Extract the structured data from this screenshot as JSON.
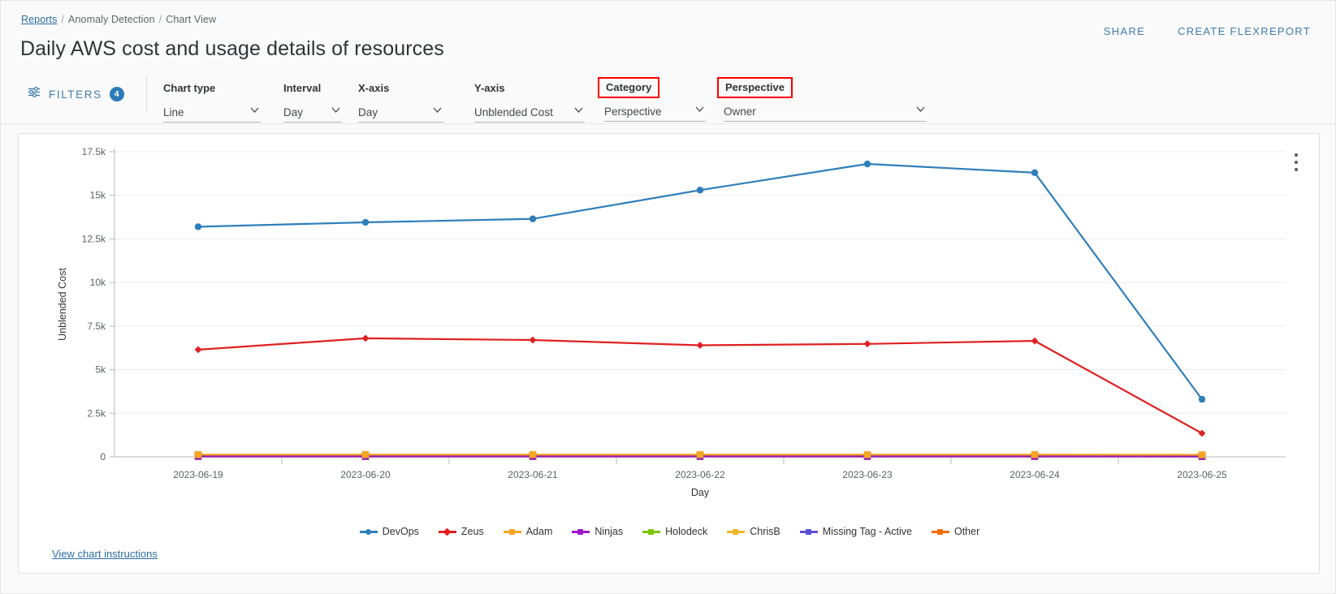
{
  "breadcrumb": {
    "root": "Reports",
    "items": [
      "Anomaly Detection",
      "Chart View"
    ],
    "separator": "/"
  },
  "header": {
    "title": "Daily AWS cost and usage details of resources",
    "actions": [
      {
        "label": "SHARE",
        "name": "share-link"
      },
      {
        "label": "CREATE FLEXREPORT",
        "name": "create-flexreport-link"
      }
    ]
  },
  "filters": {
    "label": "FILTERS",
    "count": "4",
    "fields": [
      {
        "label": "Chart type",
        "value": "Line",
        "highlighted": false
      },
      {
        "label": "Interval",
        "value": "Day",
        "highlighted": false
      },
      {
        "label": "X-axis",
        "value": "Day",
        "highlighted": false
      },
      {
        "label": "Y-axis",
        "value": "Unblended Cost",
        "highlighted": false
      },
      {
        "label": "Category",
        "value": "Perspective",
        "highlighted": true
      },
      {
        "label": "Perspective",
        "value": "Owner",
        "highlighted": true
      }
    ]
  },
  "card": {
    "menu_label": "chart-options",
    "instructions_link": "View chart instructions"
  },
  "chart_data": {
    "type": "line",
    "title": "",
    "xlabel": "Day",
    "ylabel": "Unblended Cost",
    "x": [
      "2023-06-19",
      "2023-06-20",
      "2023-06-21",
      "2023-06-22",
      "2023-06-23",
      "2023-06-24",
      "2023-06-25"
    ],
    "ylim": [
      0,
      17500
    ],
    "yticks": [
      0,
      2500,
      5000,
      7500,
      10000,
      12500,
      15000,
      17500
    ],
    "ytick_labels": [
      "0",
      "2.5k",
      "5k",
      "7.5k",
      "10k",
      "12.5k",
      "15k",
      "17.5k"
    ],
    "grid": true,
    "legend_position": "bottom",
    "series": [
      {
        "name": "DevOps",
        "color": "#2e7ebb",
        "marker": "circle",
        "values": [
          13200,
          13450,
          13650,
          15300,
          16800,
          16300,
          3300
        ]
      },
      {
        "name": "Zeus",
        "color": "#e02020",
        "marker": "diamond",
        "values": [
          6150,
          6800,
          6700,
          6400,
          6480,
          6650,
          1350
        ]
      },
      {
        "name": "Adam",
        "color": "#f5a623",
        "marker": "square",
        "values": [
          130,
          130,
          130,
          130,
          130,
          130,
          120
        ]
      },
      {
        "name": "Ninjas",
        "color": "#9b17c9",
        "marker": "square",
        "values": [
          30,
          30,
          30,
          30,
          30,
          30,
          25
        ]
      },
      {
        "name": "Holodeck",
        "color": "#7ec50a",
        "marker": "square",
        "values": [
          25,
          25,
          25,
          25,
          25,
          25,
          20
        ]
      },
      {
        "name": "ChrisB",
        "color": "#f0b429",
        "marker": "square",
        "values": [
          20,
          20,
          20,
          20,
          20,
          20,
          15
        ]
      },
      {
        "name": "Missing Tag - Active",
        "color": "#5b4fd6",
        "marker": "square",
        "values": [
          15,
          15,
          15,
          15,
          15,
          15,
          12
        ]
      },
      {
        "name": "Other",
        "color": "#ef6c00",
        "marker": "square",
        "values": [
          110,
          110,
          110,
          110,
          110,
          110,
          100
        ]
      }
    ]
  }
}
